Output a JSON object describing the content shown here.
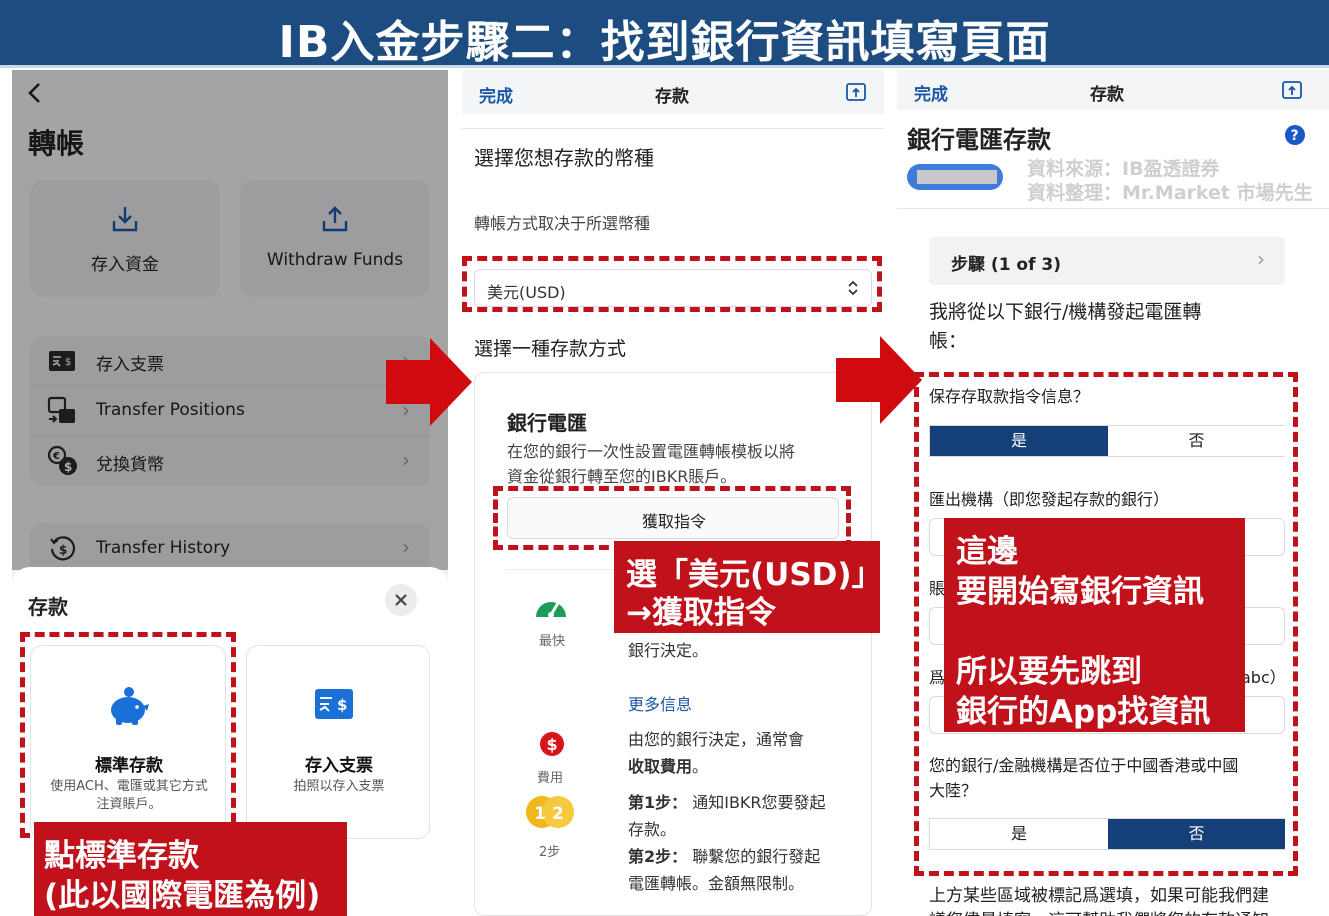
{
  "banner": {
    "title": "IB入金步驟二：找到銀行資訊填寫頁面"
  },
  "panel1": {
    "back_icon": "chevron-left-icon",
    "title": "轉帳",
    "tiles": [
      {
        "label": "存入資金",
        "icon": "download-tray-icon"
      },
      {
        "label": "Withdraw Funds",
        "icon": "upload-tray-icon"
      }
    ],
    "menu": [
      {
        "label": "存入支票",
        "icon": "cheque-icon"
      },
      {
        "label": "Transfer Positions",
        "icon": "transfer-positions-icon"
      },
      {
        "label": "兌換貨幣",
        "icon": "currency-exchange-icon"
      }
    ],
    "history": {
      "label": "Transfer History",
      "icon": "history-dollar-icon"
    },
    "sheet": {
      "title": "存款",
      "close_icon": "close-icon",
      "options": [
        {
          "title": "標準存款",
          "desc_line1": "使用ACH、電匯或其它方式",
          "desc_line2": "注資賬戶。",
          "icon": "piggy-bank-icon"
        },
        {
          "title": "存入支票",
          "desc_line1": "拍照以存入支票",
          "desc_line2": "",
          "icon": "cheque-icon"
        }
      ]
    }
  },
  "panel2": {
    "nav": {
      "done": "完成",
      "title": "存款"
    },
    "choose_currency": "選擇您想存款的幣種",
    "transfer_note": "轉帳方式取决于所選幣種",
    "currency_select": "美元(USD)",
    "choose_method": "選擇一種存款方式",
    "wire": {
      "title": "銀行電匯",
      "desc_line1": "在您的銀行一次性設置電匯轉帳模板以將",
      "desc_line2": "資金從銀行轉至您的IBKR賬戶。",
      "button": "獲取指令"
    },
    "speed_label": "最快",
    "speed_text": "銀行決定。",
    "more_info": "更多信息",
    "fee_label": "費用",
    "fee_text1": "由您的銀行決定，通常會",
    "fee_text2": "收取費用",
    "fee_text2_end": "。",
    "steps_label": "2步",
    "step1_bold": "第1步：",
    "step1_text": " 通知IBKR您要發起",
    "step1_text2": "存款。",
    "step2_bold": "第2步：",
    "step2_text": " 聯繫您的銀行發起",
    "step2_text2": "電匯轉帳。金額無限制。"
  },
  "panel3": {
    "nav": {
      "done": "完成",
      "title": "存款"
    },
    "title": "銀行電匯存款",
    "help_icon": "question-circle-icon",
    "watermark_line1": "資料來源：IB盈透證券",
    "watermark_line2": "資料整理：Mr.Market 市場先生",
    "step_box": "步驟 (1 of 3)",
    "intro_line1": "我將從以下銀行/機構發起電匯轉",
    "intro_line2": "帳：",
    "save_question": "保存存取款指令信息？",
    "yes": "是",
    "no": "否",
    "sender_label": "匯出機構（即您發起存款的銀行）",
    "partial_label1": "賬",
    "partial_label2": "爲",
    "partial_suffix": "abc）",
    "hk_question_line1": "您的銀行/金融機構是否位于中國香港或中國",
    "hk_question_line2": "大陸？",
    "footer_line1": "上方某些區域被標記爲選填，如果可能我們建",
    "footer_line2": "議您儘量填寫，這可幫助我們將您的存款通知"
  },
  "annotations": {
    "callout1_line1": "點標準存款",
    "callout1_line2": "(此以國際電匯為例)",
    "callout2_line1": "選「美元(USD)」",
    "callout2_line2": "→獲取指令",
    "callout3_line1": "這邊",
    "callout3_line2": "要開始寫銀行資訊",
    "callout3_line3": "所以要先跳到",
    "callout3_line4": "銀行的App找資訊"
  },
  "colors": {
    "banner": "#1d4d80",
    "annotation_red": "#c1121b",
    "ib_blue": "#153f78",
    "link_blue": "#1a57a7"
  }
}
